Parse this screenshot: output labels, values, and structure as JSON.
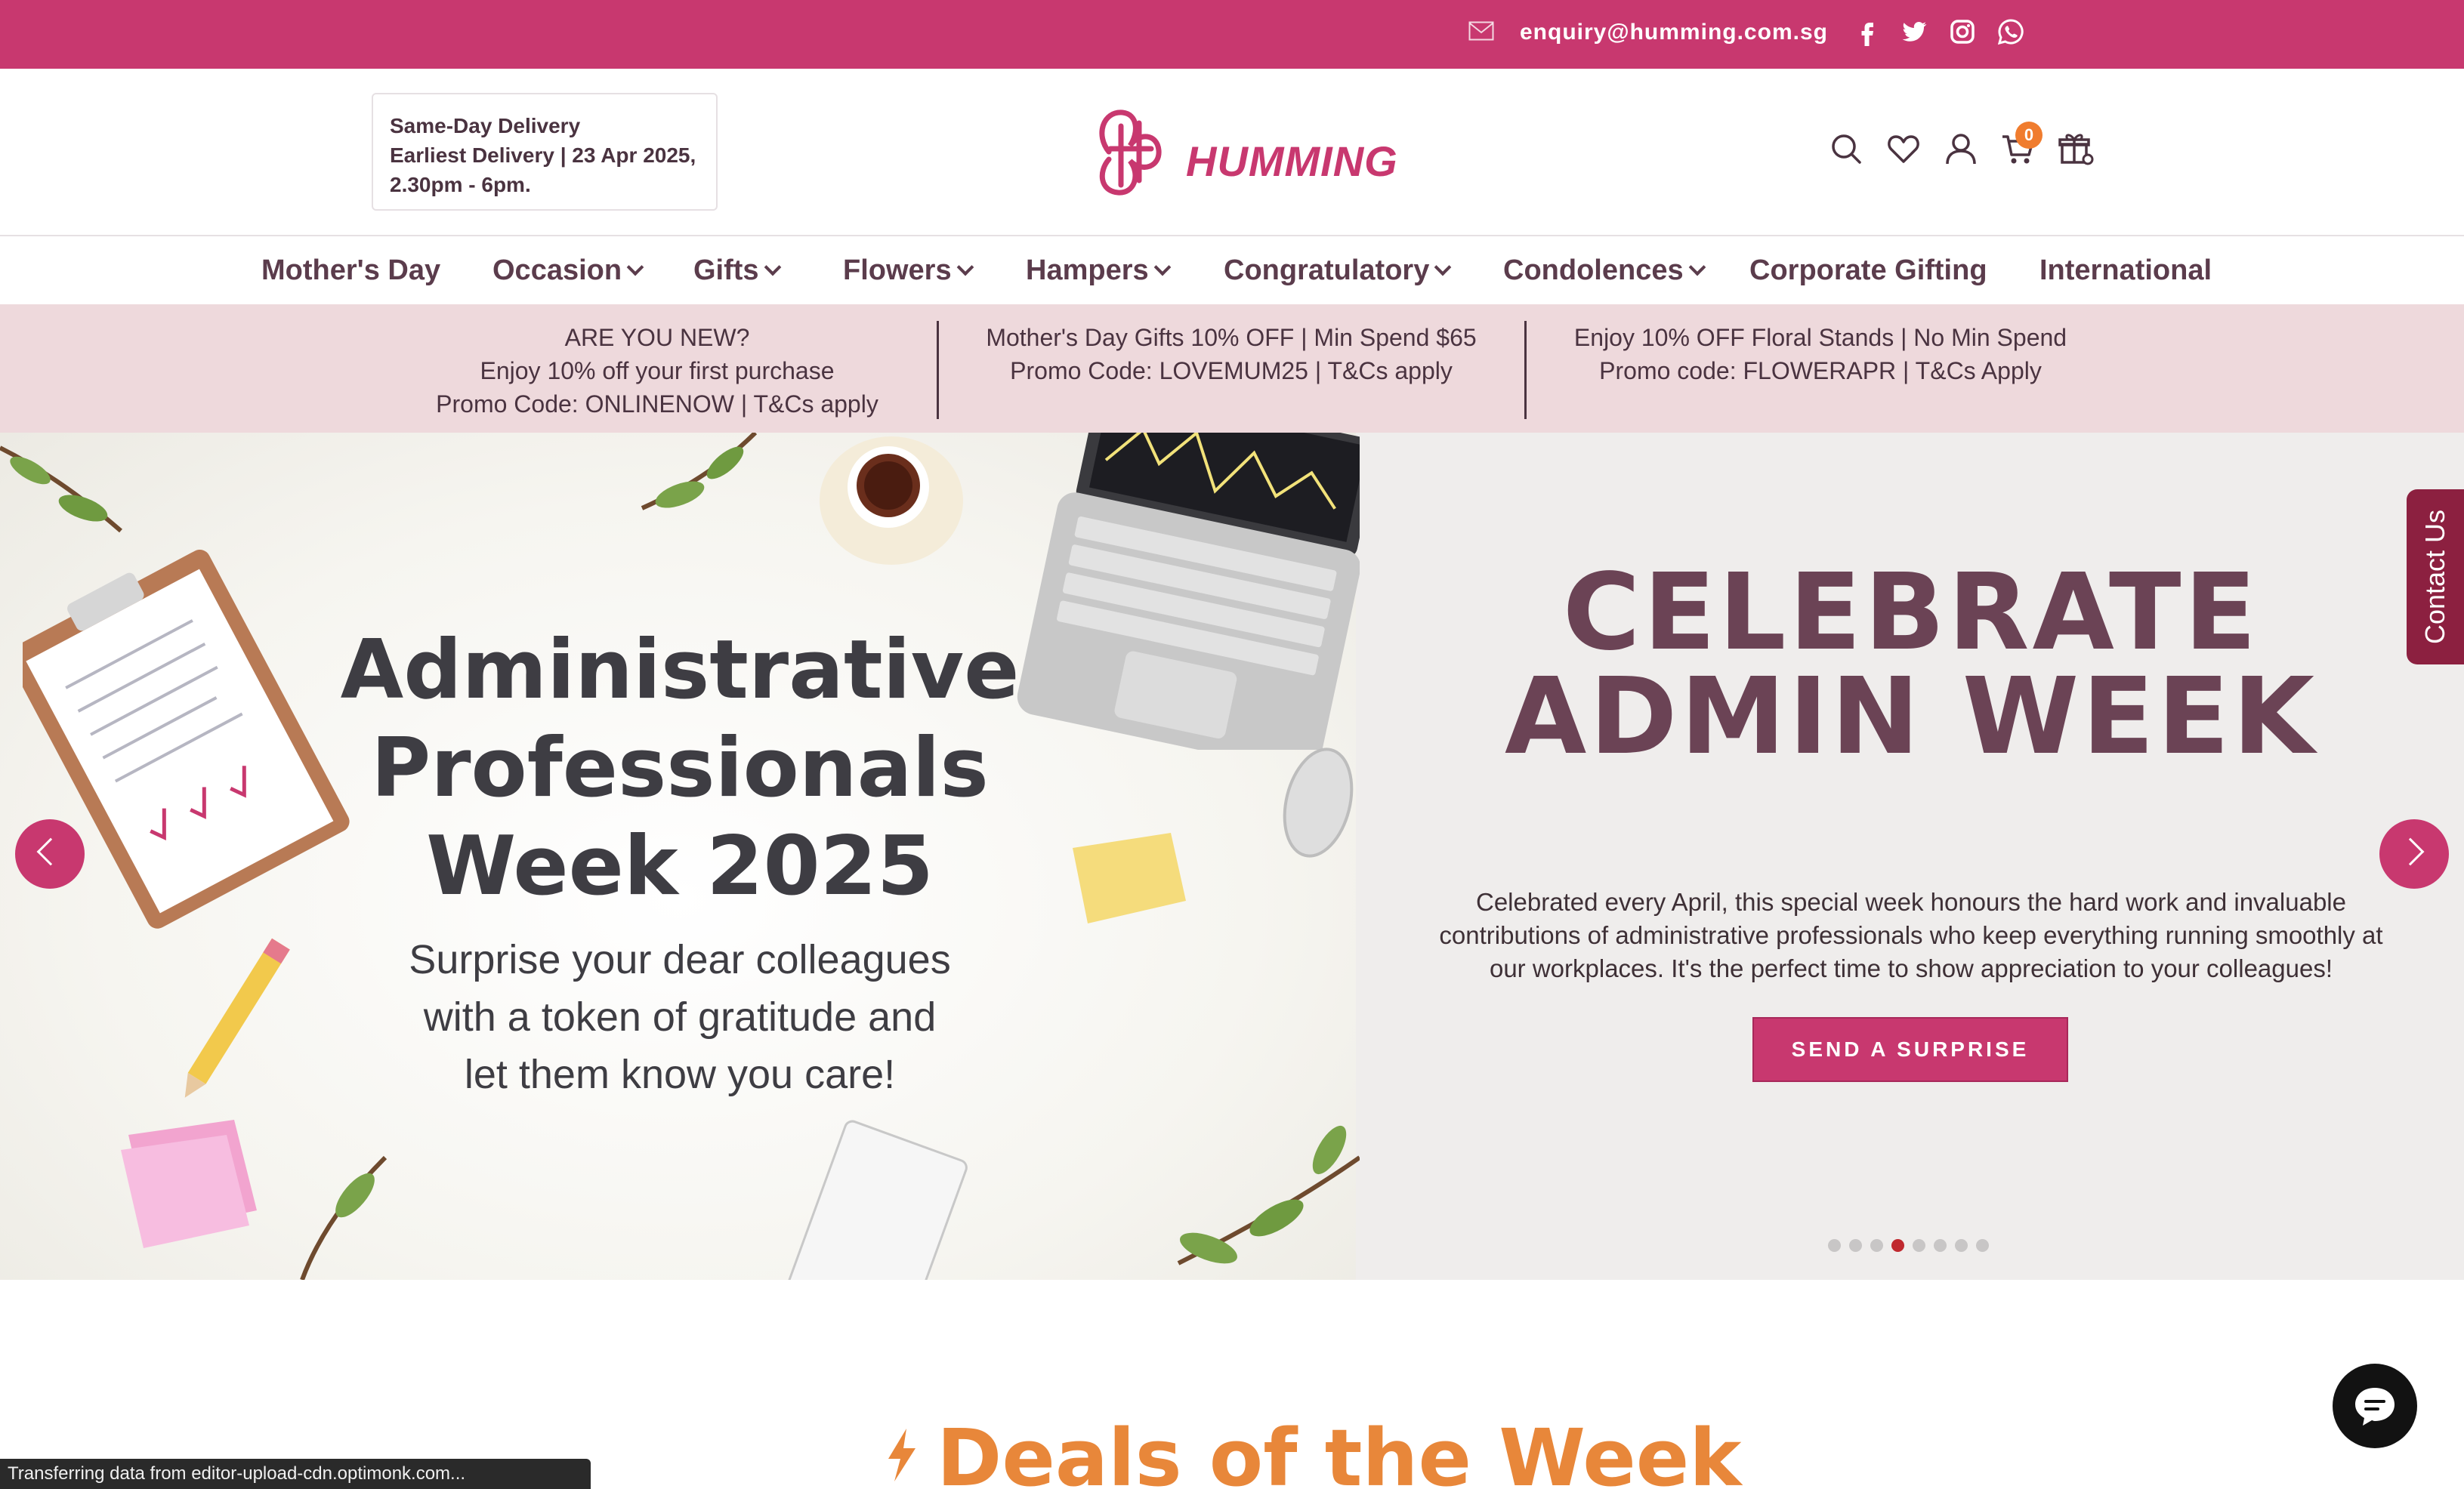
{
  "topbar": {
    "email": "enquiry@humming.com.sg",
    "social_icons": [
      "facebook-icon",
      "twitter-icon",
      "instagram-icon",
      "whatsapp-icon"
    ],
    "background": "#c8386f"
  },
  "header": {
    "delivery": {
      "line1": "Same-Day Delivery",
      "line2": "Earliest Delivery | 23 Apr 2025,",
      "line3": "2.30pm - 6pm."
    },
    "logo_text": "HUMMING",
    "cart_count": "0",
    "icons": [
      "search-icon",
      "heart-icon",
      "user-icon",
      "cart-icon",
      "gift-icon"
    ]
  },
  "nav": {
    "items": [
      {
        "label": "Mother's Day"
      },
      {
        "label": "Occasion"
      },
      {
        "label": "Gifts"
      },
      {
        "label": "Flowers"
      },
      {
        "label": "Hampers"
      },
      {
        "label": "Congratulatory"
      },
      {
        "label": "Condolences"
      },
      {
        "label": "Corporate Gifting"
      },
      {
        "label": "International"
      }
    ]
  },
  "promo": [
    {
      "lines": [
        "ARE YOU NEW?",
        "Enjoy 10% off your first purchase",
        "Promo Code: ONLINENOW | T&Cs apply"
      ]
    },
    {
      "lines": [
        "Mother's Day Gifts 10% OFF | Min Spend $65",
        "Promo Code: LOVEMUM25 | T&Cs apply"
      ]
    },
    {
      "lines": [
        "Enjoy 10% OFF Floral Stands | No Min Spend",
        "Promo code: FLOWERAPR | T&Cs Apply"
      ]
    }
  ],
  "hero": {
    "banner_title": [
      "Administrative",
      "Professionals",
      "Week 2025"
    ],
    "banner_subtitle": [
      "Surprise your dear colleagues",
      "with a token of gratitude and",
      "let them know you care!"
    ],
    "heading": [
      "CELEBRATE",
      "ADMIN WEEK"
    ],
    "description": [
      "Celebrated every April, this special week honours the hard work and invaluable",
      "contributions of administrative professionals who keep everything running smoothly at",
      "our workplaces. It's the perfect time to show appreciation to your colleagues!"
    ],
    "cta": "SEND A SURPRISE",
    "slides_total": 8,
    "active_slide": 4,
    "accent": "#c8386f",
    "heading_color": "#6b4355"
  },
  "contact_tab": "Contact Us",
  "deals": {
    "title": "Deals of the Week",
    "color": "#e8873a"
  },
  "status_bar": "Transferring data from editor-upload-cdn.optimonk.com..."
}
